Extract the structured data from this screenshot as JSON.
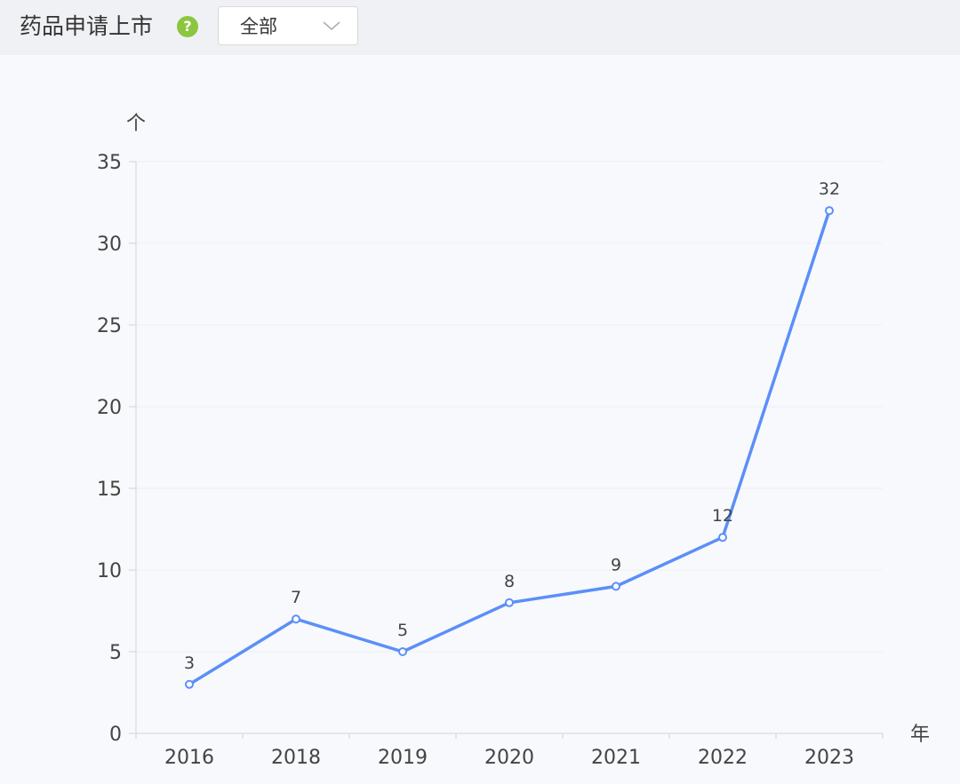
{
  "header": {
    "title": "药品申请上市",
    "help_icon": "question-circle-icon",
    "filter_value": "全部",
    "filter_icon": "chevron-down-icon"
  },
  "colors": {
    "line": "#5b8ff9",
    "grid": "#edf0f5",
    "axis": "#d0d3da",
    "text": "#444444",
    "help": "#8cc63f"
  },
  "chart_data": {
    "type": "line",
    "categories": [
      "2016",
      "2018",
      "2019",
      "2020",
      "2021",
      "2022",
      "2023"
    ],
    "values": [
      3,
      7,
      5,
      8,
      9,
      12,
      32
    ],
    "xlabel": "年",
    "ylabel": "个",
    "ylim": [
      0,
      35
    ],
    "yticks": [
      0,
      5,
      10,
      15,
      20,
      25,
      30,
      35
    ],
    "grid": true,
    "data_labels": true,
    "legend": "none"
  }
}
